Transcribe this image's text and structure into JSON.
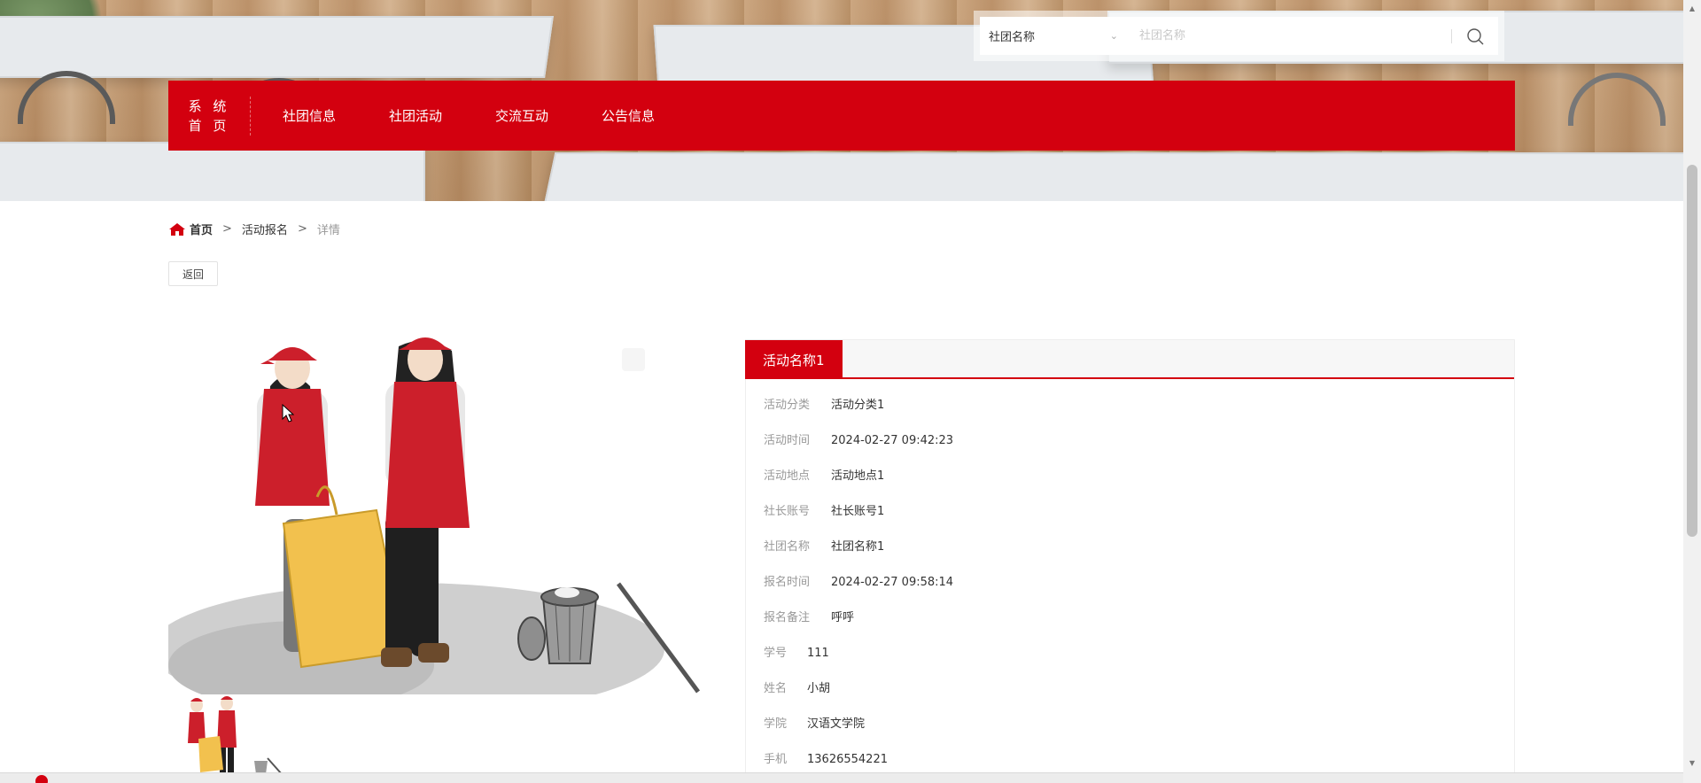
{
  "colors": {
    "brand": "#d3000f",
    "label": "#999999",
    "text": "#333333"
  },
  "search": {
    "field_selected": "社团名称",
    "placeholder": "社团名称",
    "icon": "search-icon"
  },
  "nav": {
    "system_home_line1": "系 统",
    "system_home_line2": "首 页",
    "items": [
      "社团信息",
      "社团活动",
      "交流互动",
      "公告信息"
    ]
  },
  "breadcrumb": {
    "home": "首页",
    "sep": ">",
    "section": "活动报名",
    "current": "详情",
    "icon": "home-icon"
  },
  "back_label": "返回",
  "detail": {
    "title": "活动名称1",
    "fields": [
      {
        "label": "活动分类",
        "value": "活动分类1"
      },
      {
        "label": "活动时间",
        "value": "2024-02-27 09:42:23"
      },
      {
        "label": "活动地点",
        "value": "活动地点1"
      },
      {
        "label": "社长账号",
        "value": "社长账号1"
      },
      {
        "label": "社团名称",
        "value": "社团名称1"
      },
      {
        "label": "报名时间",
        "value": "2024-02-27 09:58:14"
      },
      {
        "label": "报名备注",
        "value": "呼呼"
      },
      {
        "label": "学号",
        "value": "111"
      },
      {
        "label": "姓名",
        "value": "小胡"
      },
      {
        "label": "学院",
        "value": "汉语文学院"
      },
      {
        "label": "手机",
        "value": "13626554221"
      }
    ]
  }
}
